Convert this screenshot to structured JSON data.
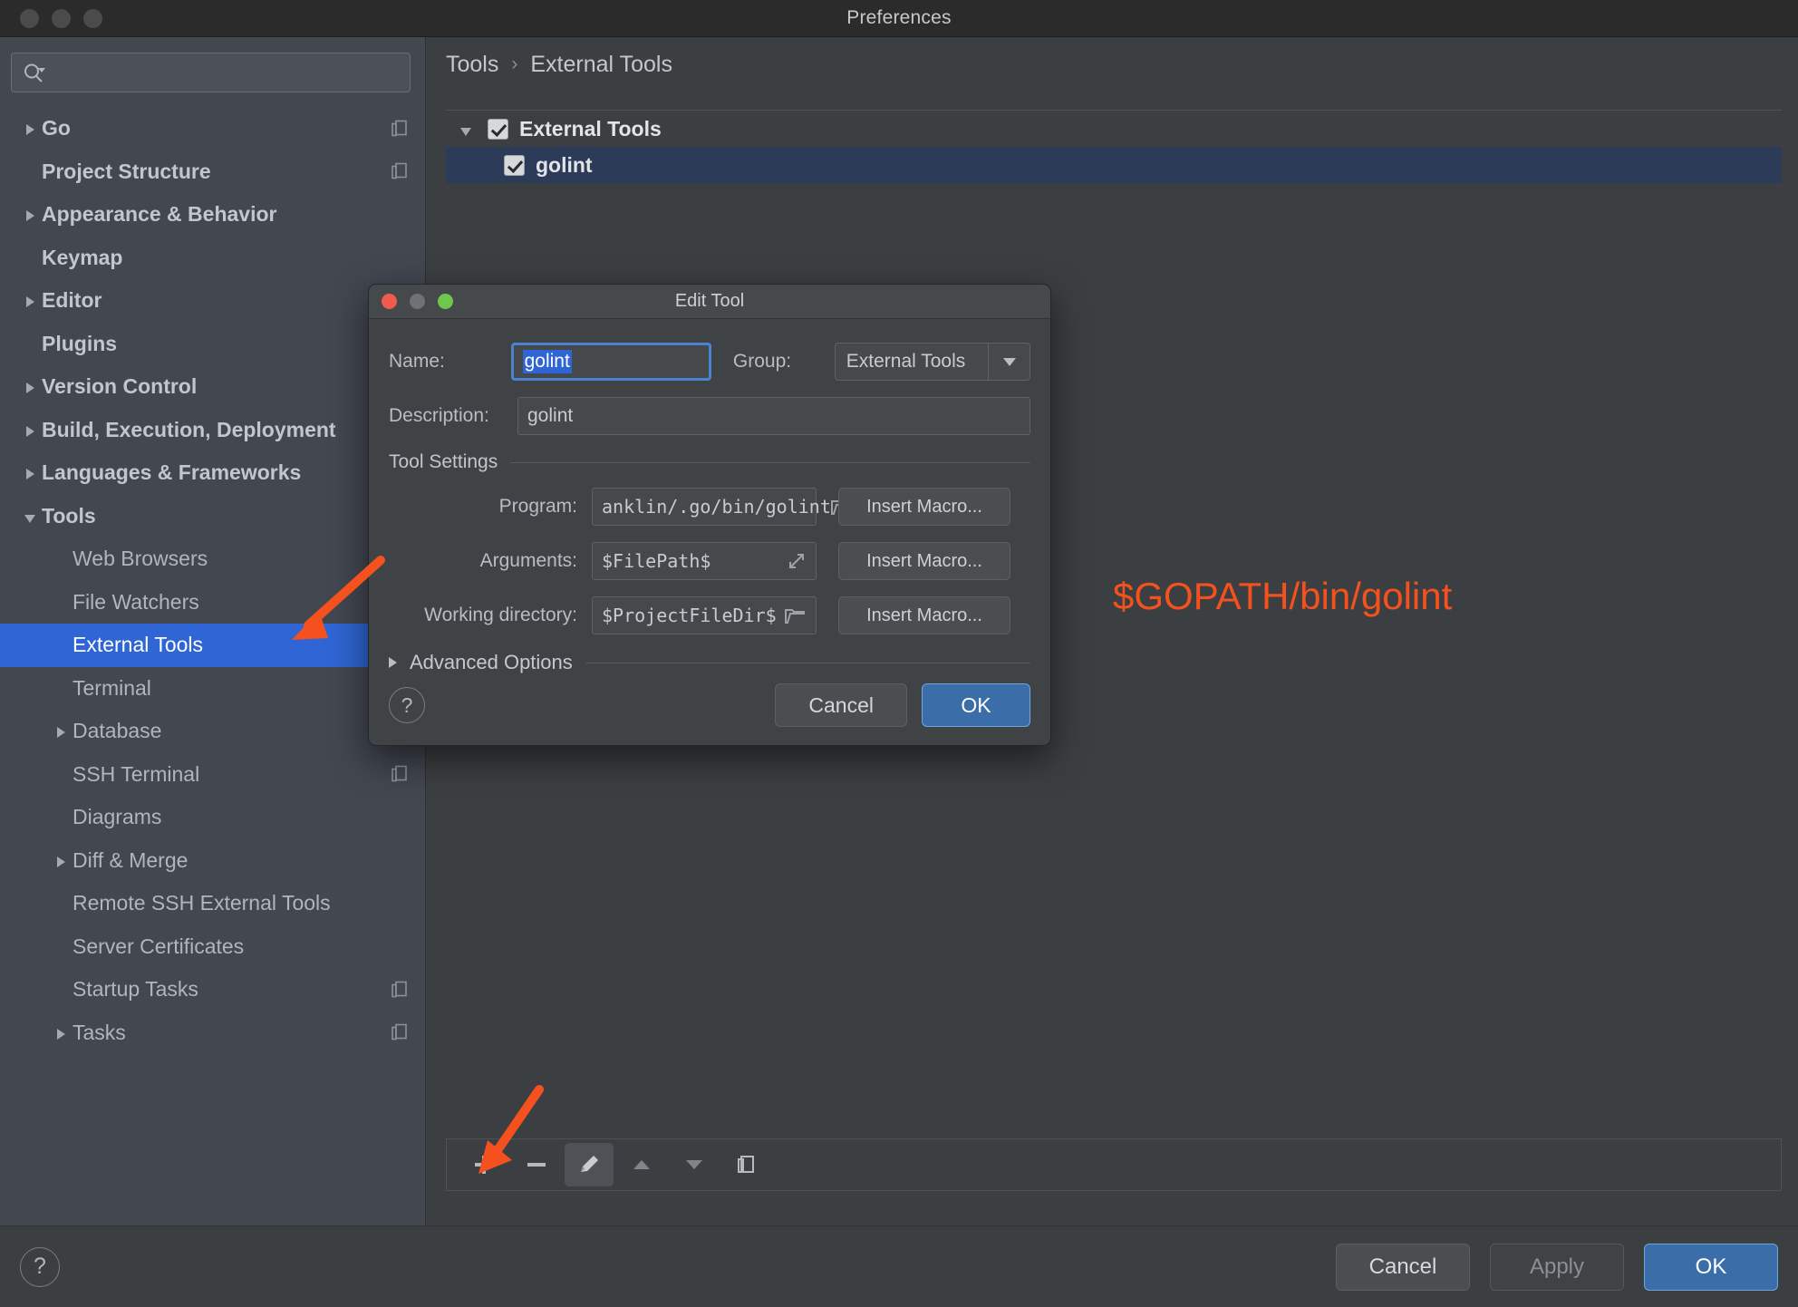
{
  "window": {
    "title": "Preferences",
    "traffic_lights": [
      "close-dot",
      "minimize-dot",
      "zoom-dot"
    ]
  },
  "sidebar": {
    "search": {
      "placeholder": "",
      "value": "",
      "icon": "search-icon"
    },
    "items": [
      {
        "label": "Go",
        "level": 0,
        "twisty": "right",
        "badge": true
      },
      {
        "label": "Project Structure",
        "level": 0,
        "twisty": "none",
        "badge": true
      },
      {
        "label": "Appearance & Behavior",
        "level": 0,
        "twisty": "right",
        "badge": false
      },
      {
        "label": "Keymap",
        "level": 0,
        "twisty": "none",
        "badge": false
      },
      {
        "label": "Editor",
        "level": 0,
        "twisty": "right",
        "badge": false
      },
      {
        "label": "Plugins",
        "level": 0,
        "twisty": "none",
        "badge": false
      },
      {
        "label": "Version Control",
        "level": 0,
        "twisty": "right",
        "badge": true
      },
      {
        "label": "Build, Execution, Deployment",
        "level": 0,
        "twisty": "right",
        "badge": false
      },
      {
        "label": "Languages & Frameworks",
        "level": 0,
        "twisty": "right",
        "badge": false
      },
      {
        "label": "Tools",
        "level": 0,
        "twisty": "down",
        "badge": false
      },
      {
        "label": "Web Browsers",
        "level": 1,
        "twisty": "none",
        "badge": false
      },
      {
        "label": "File Watchers",
        "level": 1,
        "twisty": "none",
        "badge": true
      },
      {
        "label": "External Tools",
        "level": 1,
        "twisty": "none",
        "badge": false,
        "selected": true
      },
      {
        "label": "Terminal",
        "level": 1,
        "twisty": "none",
        "badge": true
      },
      {
        "label": "Database",
        "level": 1,
        "twisty": "right",
        "badge": false
      },
      {
        "label": "SSH Terminal",
        "level": 1,
        "twisty": "none",
        "badge": true
      },
      {
        "label": "Diagrams",
        "level": 1,
        "twisty": "none",
        "badge": false
      },
      {
        "label": "Diff & Merge",
        "level": 1,
        "twisty": "right",
        "badge": false
      },
      {
        "label": "Remote SSH External Tools",
        "level": 1,
        "twisty": "none",
        "badge": false
      },
      {
        "label": "Server Certificates",
        "level": 1,
        "twisty": "none",
        "badge": false
      },
      {
        "label": "Startup Tasks",
        "level": 1,
        "twisty": "none",
        "badge": true
      },
      {
        "label": "Tasks",
        "level": 1,
        "twisty": "right",
        "badge": true
      }
    ]
  },
  "breadcrumb": {
    "parent": "Tools",
    "separator": "›",
    "current": "External Tools"
  },
  "tools_list": {
    "group": {
      "label": "External Tools",
      "checked": true,
      "expanded": true
    },
    "items": [
      {
        "label": "golint",
        "checked": true,
        "selected": true
      }
    ]
  },
  "list_toolbar": {
    "buttons": [
      {
        "name": "add-button",
        "glyph": "+"
      },
      {
        "name": "remove-button",
        "glyph": "−"
      },
      {
        "name": "edit-button",
        "glyph": "pencil-icon",
        "active": true
      },
      {
        "name": "move-up-button",
        "glyph": "triangle-up-icon"
      },
      {
        "name": "move-down-button",
        "glyph": "triangle-down-icon"
      },
      {
        "name": "copy-button",
        "glyph": "copy-icon"
      }
    ]
  },
  "footer": {
    "help_label": "?",
    "cancel_label": "Cancel",
    "apply_label": "Apply",
    "ok_label": "OK"
  },
  "dialog": {
    "title": "Edit Tool",
    "traffic_lights": [
      "close-dot",
      "minimize-dot",
      "zoom-dot"
    ],
    "name_label": "Name:",
    "name_value": "golint",
    "group_label": "Group:",
    "group_value": "External Tools",
    "description_label": "Description:",
    "description_value": "golint",
    "section_title": "Tool Settings",
    "program_label": "Program:",
    "program_value": "anklin/.go/bin/golint",
    "program_browse_icon": "folder-icon",
    "program_macro_label": "Insert Macro...",
    "arguments_label": "Arguments:",
    "arguments_value": "$FilePath$",
    "arguments_expand_icon": "expand-icon",
    "arguments_macro_label": "Insert Macro...",
    "workdir_label": "Working directory:",
    "workdir_value": "$ProjectFileDir$",
    "workdir_browse_icon": "folder-icon",
    "workdir_macro_label": "Insert Macro...",
    "advanced_label": "Advanced Options",
    "help_label": "?",
    "cancel_label": "Cancel",
    "ok_label": "OK"
  },
  "annotations": {
    "color": "#f4511e",
    "program_note": "$GOPATH/bin/golint",
    "arrow_to_external_tools": "arrow-icon",
    "arrow_to_add_button": "arrow-icon"
  }
}
